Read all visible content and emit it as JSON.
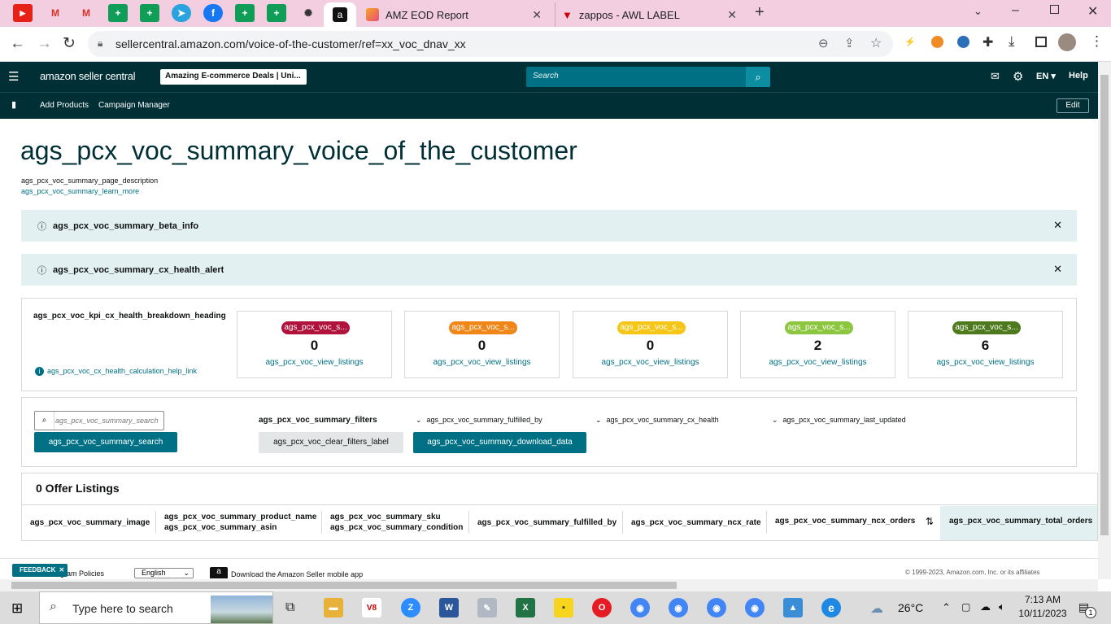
{
  "browser": {
    "tabs": [
      {
        "title": "AMZ EOD Report"
      },
      {
        "title": "zappos - AWL LABEL"
      }
    ],
    "url": "sellercentral.amazon.com/voice-of-the-customer/ref=xx_voc_dnav_xx"
  },
  "header": {
    "logo": "amazon seller central",
    "store_selector": "Amazing E-commerce Deals | Uni...",
    "search_placeholder": "Search",
    "language": "EN",
    "help": "Help"
  },
  "subnav": {
    "items": [
      "Add Products",
      "Campaign Manager"
    ],
    "edit": "Edit"
  },
  "page": {
    "title": "ags_pcx_voc_summary_voice_of_the_customer",
    "description": "ags_pcx_voc_summary_page_description",
    "learn_more": "ags_pcx_voc_summary_learn_more"
  },
  "banners": [
    {
      "text": "ags_pcx_voc_summary_beta_info"
    },
    {
      "text": "ags_pcx_voc_summary_cx_health_alert"
    }
  ],
  "kpi": {
    "heading": "ags_pcx_voc_kpi_cx_health_breakdown_heading",
    "help_link": "ags_pcx_voc_cx_health_calculation_help_link",
    "cards": [
      {
        "label": "ags_pcx_voc_s...",
        "value": "0",
        "link": "ags_pcx_voc_view_listings",
        "color": "#b0123c"
      },
      {
        "label": "ags_pcx_voc_s...",
        "value": "0",
        "link": "ags_pcx_voc_view_listings",
        "color": "#f08518"
      },
      {
        "label": "ags_pcx_voc_s...",
        "value": "0",
        "link": "ags_pcx_voc_view_listings",
        "color": "#f5c518"
      },
      {
        "label": "ags_pcx_voc_s...",
        "value": "2",
        "link": "ags_pcx_voc_view_listings",
        "color": "#8cc63f"
      },
      {
        "label": "ags_pcx_voc_s...",
        "value": "6",
        "link": "ags_pcx_voc_view_listings",
        "color": "#4d7a1c"
      }
    ]
  },
  "filters": {
    "search_placeholder": "ags_pcx_voc_summary_search",
    "search_button": "ags_pcx_voc_summary_search",
    "filters_label": "ags_pcx_voc_summary_filters",
    "clear_filters": "ags_pcx_voc_clear_filters_label",
    "download": "ags_pcx_voc_summary_download_data",
    "dropdowns": [
      "ags_pcx_voc_summary_fulfilled_by",
      "ags_pcx_voc_summary_cx_health",
      "ags_pcx_voc_summary_last_updated"
    ]
  },
  "listings": {
    "count_label": "0 Offer Listings",
    "columns": {
      "image": "ags_pcx_voc_summary_image",
      "product_name": "ags_pcx_voc_summary_product_name",
      "asin": "ags_pcx_voc_summary_asin",
      "sku": "ags_pcx_voc_summary_sku",
      "condition": "ags_pcx_voc_summary_condition",
      "fulfilled_by": "ags_pcx_voc_summary_fulfilled_by",
      "ncx_rate": "ags_pcx_voc_summary_ncx_rate",
      "ncx_orders": "ags_pcx_voc_summary_ncx_orders",
      "total_orders": "ags_pcx_voc_summary_total_orders"
    }
  },
  "footer": {
    "feedback": "FEEDBACK",
    "program_policies": "Program Policies",
    "language": "English",
    "app": "Download the Amazon Seller mobile app",
    "copyright": "© 1999-2023, Amazon.com, Inc. or its affiliates"
  },
  "taskbar": {
    "search_placeholder": "Type here to search",
    "weather": "26°C",
    "time": "7:13 AM",
    "date": "10/11/2023",
    "notifications": "1"
  }
}
